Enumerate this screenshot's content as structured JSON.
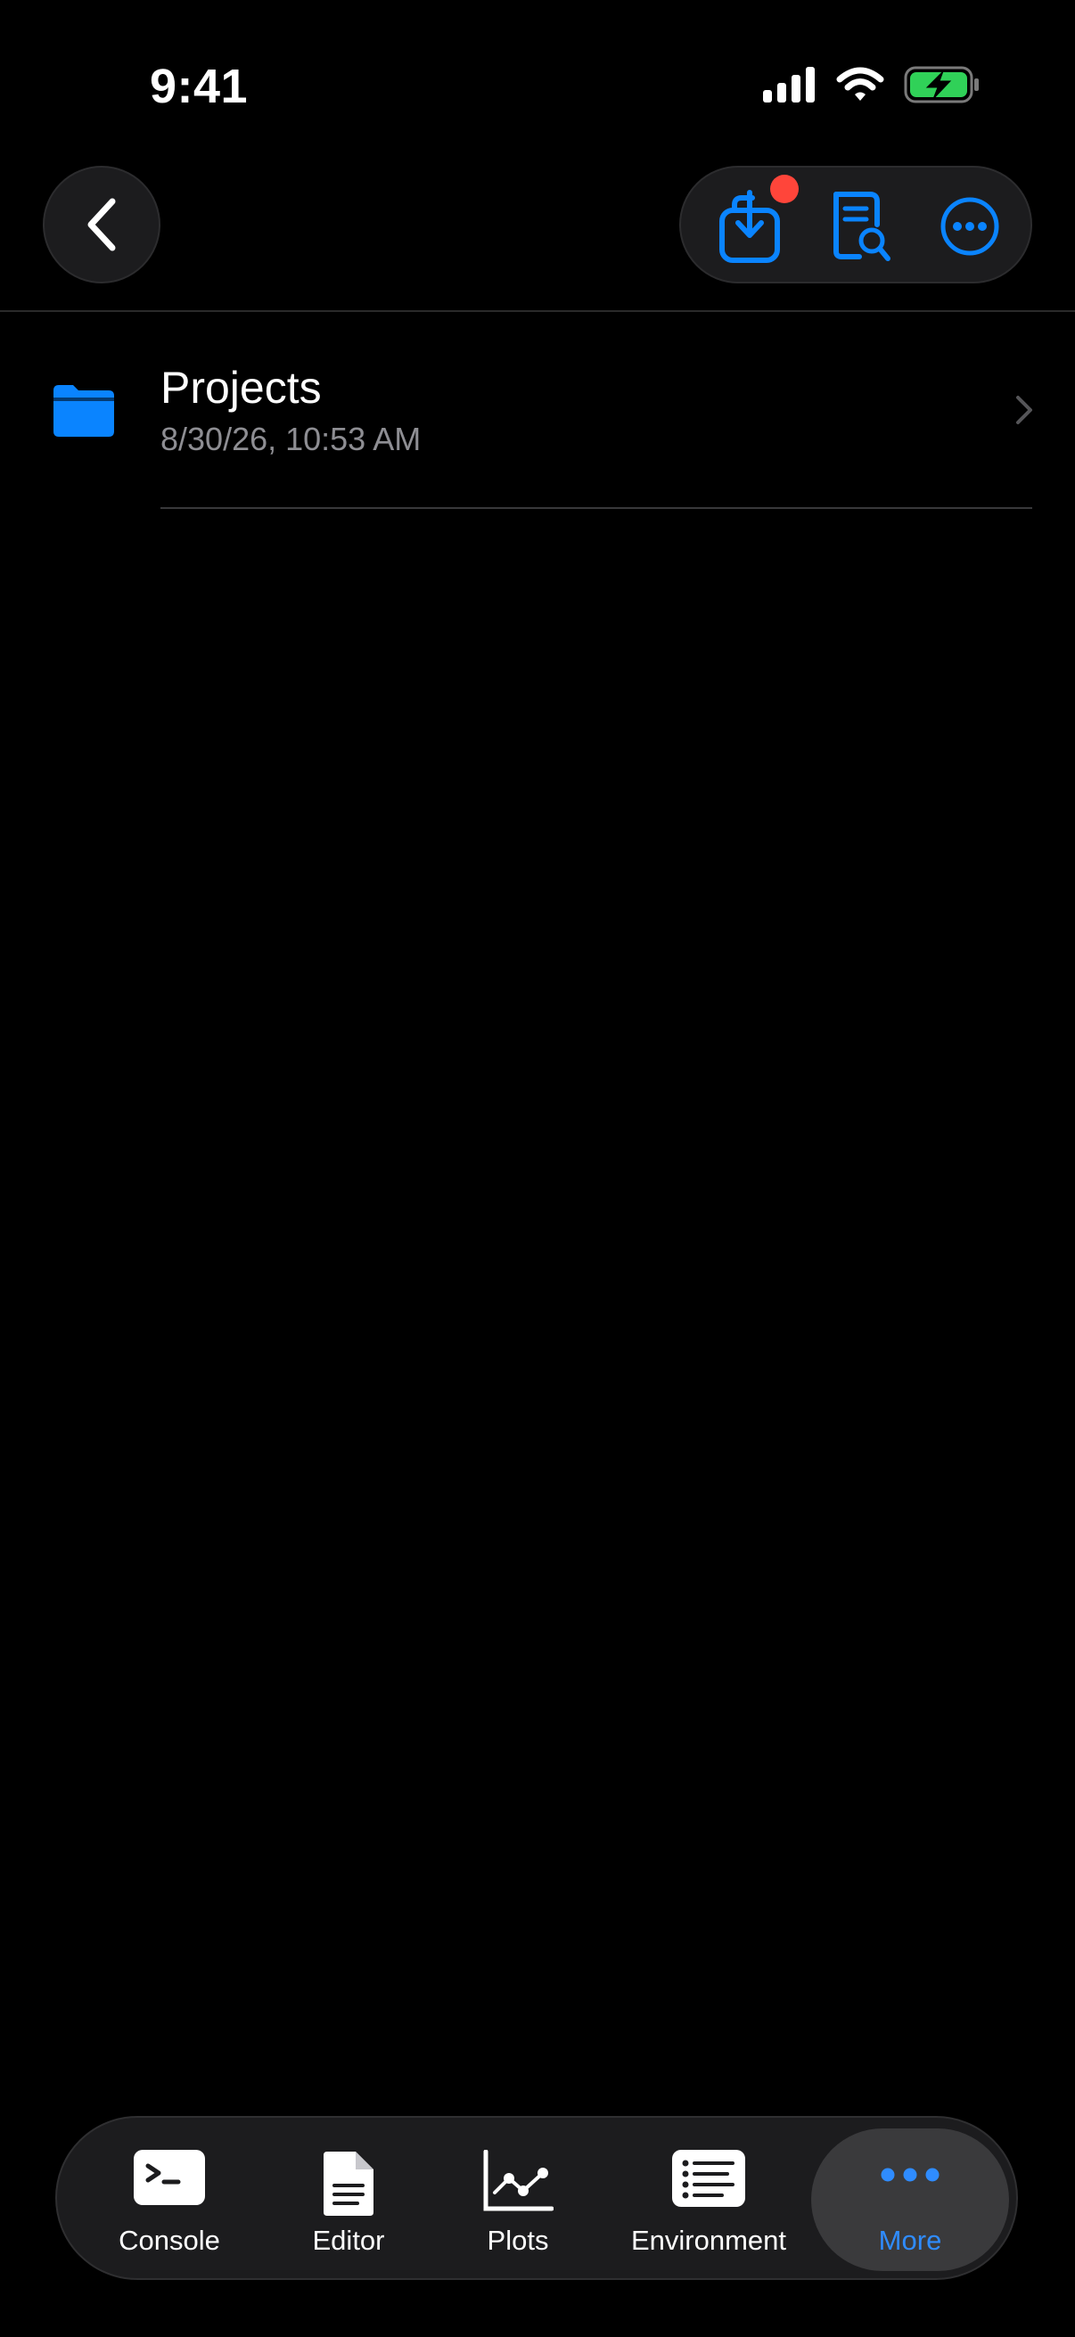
{
  "status_bar": {
    "time": "9:41"
  },
  "nav": {
    "actions": [
      "download-inbox-icon",
      "document-search-icon",
      "ellipsis-circle-icon"
    ]
  },
  "files": [
    {
      "name": "Projects",
      "date": "8/30/26, 10:53 AM",
      "icon": "folder-icon"
    }
  ],
  "tab_bar": {
    "tabs": [
      {
        "label": "Console",
        "icon": "terminal-icon"
      },
      {
        "label": "Editor",
        "icon": "document-icon"
      },
      {
        "label": "Plots",
        "icon": "line-chart-icon"
      },
      {
        "label": "Environment",
        "icon": "list-icon"
      },
      {
        "label": "More",
        "icon": "more-icon",
        "active": true
      }
    ]
  },
  "colors": {
    "accent": "#0a84ff",
    "active_tab_label": "#2f8cff",
    "badge": "#ff453a",
    "battery": "#30d158",
    "secondary_text": "#8e8e93"
  }
}
